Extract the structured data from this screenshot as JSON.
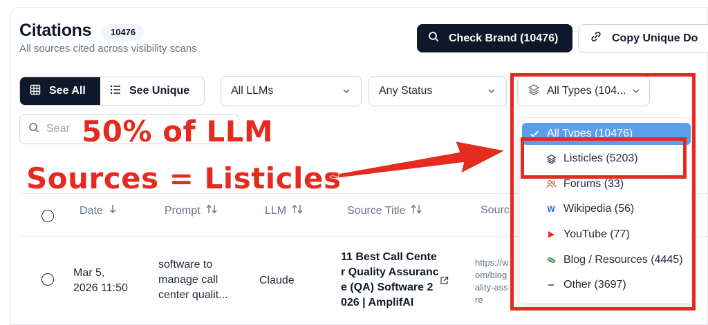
{
  "header": {
    "title": "Citations",
    "count": "10476",
    "subtitle": "All sources cited across visibility scans"
  },
  "actions": {
    "check_brand": "Check Brand (10476)",
    "copy_unique": "Copy Unique Do"
  },
  "filters": {
    "see_all": "See All",
    "see_unique": "See Unique",
    "llm_select": "All LLMs",
    "status_select": "Any Status",
    "type_select": "All Types (104...",
    "search_placeholder": "Sear"
  },
  "types_dropdown": {
    "items": [
      {
        "label": "All Types (10476)",
        "icon": "check-icon"
      },
      {
        "label": "Listicles (5203)",
        "icon": "layers-icon"
      },
      {
        "label": "Forums (33)",
        "icon": "users-icon"
      },
      {
        "label": "Wikipedia (56)",
        "icon": "wikipedia-icon"
      },
      {
        "label": "YouTube (77)",
        "icon": "youtube-icon"
      },
      {
        "label": "Blog / Resources (4445)",
        "icon": "leaf-icon"
      },
      {
        "label": "Other (3697)",
        "icon": "dash-icon"
      }
    ]
  },
  "table": {
    "columns": [
      "Date",
      "Prompt",
      "LLM",
      "Source Title",
      "Sourc"
    ],
    "rows": [
      {
        "date_line1": "Mar 5,",
        "date_line2": "2026 11:50",
        "prompt_line1": "software to",
        "prompt_line2": "manage call",
        "prompt_line3": "center qualit...",
        "llm": "Claude",
        "title_line1": "11 Best Call Cente",
        "title_line2": "r Quality Assuranc",
        "title_line3": "e (QA) Software 2",
        "title_line4": "026 | AmplifAI",
        "url_line1": "https://w",
        "url_line2": "om/blog",
        "url_line3": "ality-ass",
        "url_line4": "re"
      }
    ]
  },
  "annotation": {
    "line1": "50% of LLM",
    "line2": "Sources = Listicles",
    "color": "#e52b1f"
  }
}
